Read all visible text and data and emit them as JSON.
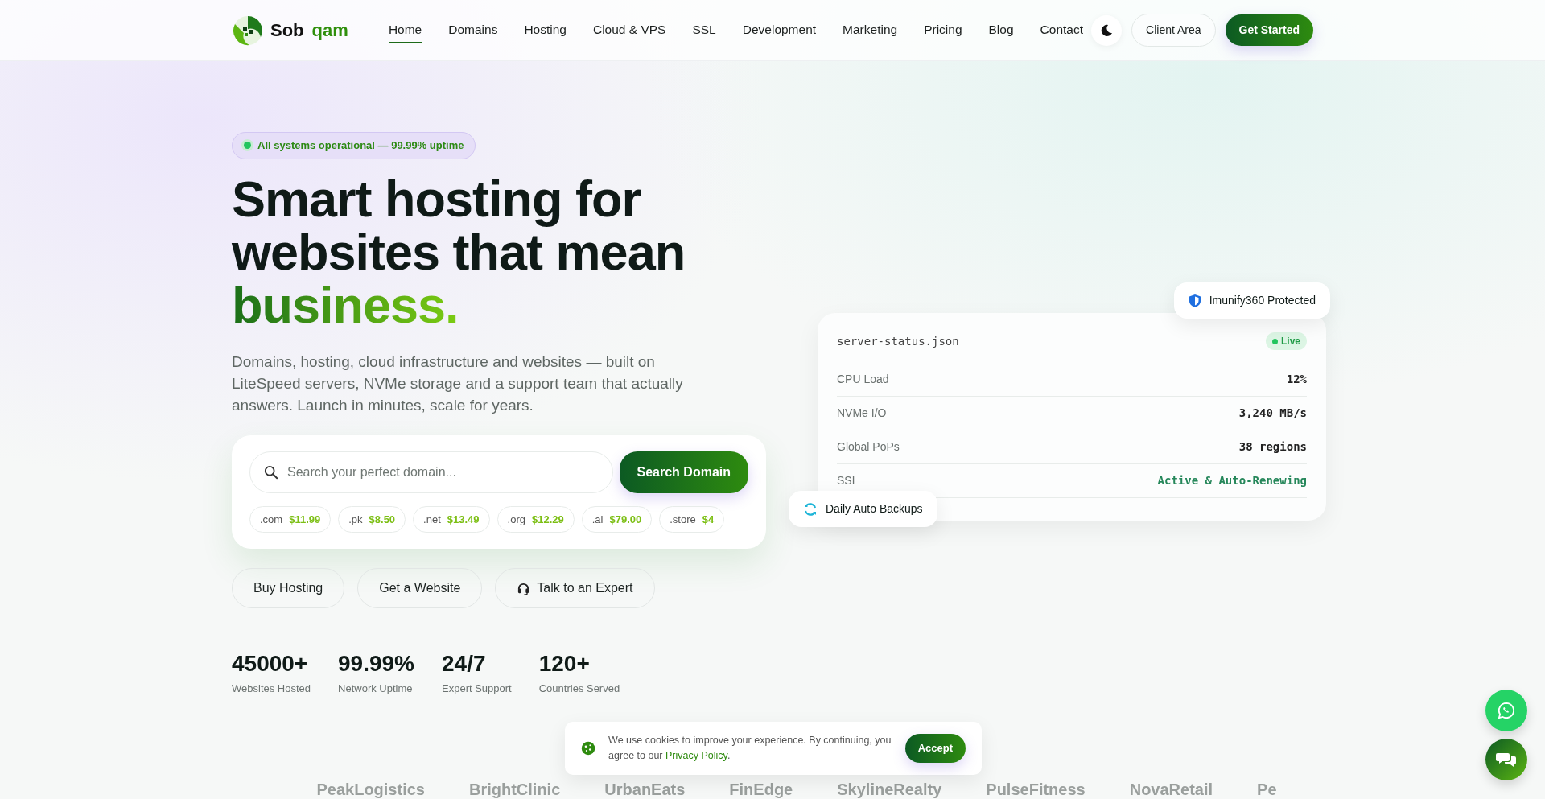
{
  "header": {
    "logo": {
      "first": "Sob",
      "second": "qam"
    },
    "nav": [
      {
        "label": "Home",
        "selected": true
      },
      {
        "label": "Domains",
        "selected": false
      },
      {
        "label": "Hosting",
        "selected": false
      },
      {
        "label": "Cloud & VPS",
        "selected": false
      },
      {
        "label": "SSL",
        "selected": false
      },
      {
        "label": "Development",
        "selected": false
      },
      {
        "label": "Marketing",
        "selected": false
      },
      {
        "label": "Pricing",
        "selected": false
      },
      {
        "label": "Blog",
        "selected": false
      },
      {
        "label": "Contact",
        "selected": false
      }
    ],
    "client_area": "Client Area",
    "cta": "Get Started"
  },
  "hero": {
    "status_badge": "All systems operational — 99.99% uptime",
    "headline": [
      "Smart hosting for",
      "websites that mean"
    ],
    "headline_accent": "business.",
    "description": "Domains, hosting, cloud infrastructure and websites — built on LiteSpeed servers, NVMe storage and a support team that actually answers. Launch in minutes, scale for years.",
    "search": {
      "placeholder": "Search your perfect domain...",
      "button": "Search Domain",
      "tlds": [
        {
          "ext": ".com",
          "price": "$11.99"
        },
        {
          "ext": ".pk",
          "price": "$8.50"
        },
        {
          "ext": ".net",
          "price": "$13.49"
        },
        {
          "ext": ".org",
          "price": "$12.29"
        },
        {
          "ext": ".ai",
          "price": "$79.00"
        },
        {
          "ext": ".store",
          "price": "$4"
        }
      ]
    },
    "actions": [
      {
        "label": "Buy Hosting",
        "kind": "plain"
      },
      {
        "label": "Get a Website",
        "kind": "plain"
      },
      {
        "label": "Talk to an Expert",
        "kind": "support"
      }
    ],
    "stats": [
      {
        "value": "45000+",
        "label": "Websites Hosted"
      },
      {
        "value": "99.99%",
        "label": "Network Uptime"
      },
      {
        "value": "24/7",
        "label": "Expert Support"
      },
      {
        "value": "120+",
        "label": "Countries Served"
      }
    ]
  },
  "server_status": {
    "filename": "server-status.json",
    "live": "Live",
    "rows": [
      {
        "label": "CPU Load",
        "value": "12%",
        "kind": "plain"
      },
      {
        "label": "NVMe I/O",
        "value": "3,240 MB/s",
        "kind": "plain"
      },
      {
        "label": "Global PoPs",
        "value": "38 regions",
        "kind": "plain"
      },
      {
        "label": "SSL",
        "value": "Active & Auto-Renewing",
        "kind": "success"
      }
    ]
  },
  "floating_badges": {
    "protection": "Imunify360 Protected",
    "backups": "Daily Auto Backups"
  },
  "clients": [
    "PeakLogistics",
    "BrightClinic",
    "UrbanEats",
    "FinEdge",
    "SkylineRealty",
    "PulseFitness",
    "NovaRetail",
    "Pe"
  ],
  "cookie_banner": {
    "text": "We use cookies to improve your experience. By continuing, you agree to our ",
    "link": "Privacy Policy",
    "suffix": ".",
    "button": "Accept"
  }
}
